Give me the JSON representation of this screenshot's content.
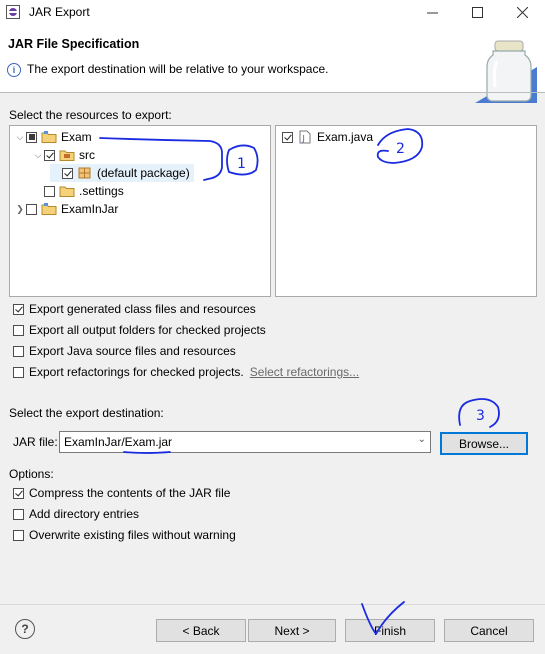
{
  "window": {
    "title": "JAR Export"
  },
  "header": {
    "title": "JAR File Specification",
    "message": "The export destination will be relative to your workspace."
  },
  "resources": {
    "label": "Select the resources to export:",
    "tree": [
      {
        "label": "Exam",
        "state": "partial",
        "expanded": true
      },
      {
        "label": "src",
        "state": "checked",
        "expanded": true
      },
      {
        "label": "(default package)",
        "state": "checked",
        "selected": true
      },
      {
        "label": ".settings",
        "state": "unchecked"
      },
      {
        "label": "ExamInJar",
        "state": "unchecked",
        "expanded": false
      }
    ],
    "files": [
      {
        "label": "Exam.java",
        "state": "checked"
      }
    ]
  },
  "options": {
    "export_class_files": "Export generated class files and resources",
    "export_output_folders": "Export all output folders for checked projects",
    "export_java_source": "Export Java source files and resources",
    "export_refactorings": "Export refactorings for checked projects.",
    "select_refactorings": "Select refactorings..."
  },
  "destination": {
    "label": "Select the export destination:",
    "jar_label": "JAR file:",
    "jar_value": "ExamInJar/Exam.jar",
    "browse": "Browse..."
  },
  "jar_options": {
    "label": "Options:",
    "compress": "Compress the contents of the JAR file",
    "add_directory": "Add directory entries",
    "overwrite": "Overwrite existing files without warning"
  },
  "buttons": {
    "back": "< Back",
    "next": "Next >",
    "finish": "Finish",
    "cancel": "Cancel"
  },
  "annotations": {
    "mark1": "1",
    "mark2": "2",
    "mark3": "3",
    "color": "#1a2be0"
  },
  "colors": {
    "selection": "#e5f1fb",
    "focus": "#0078d7"
  }
}
